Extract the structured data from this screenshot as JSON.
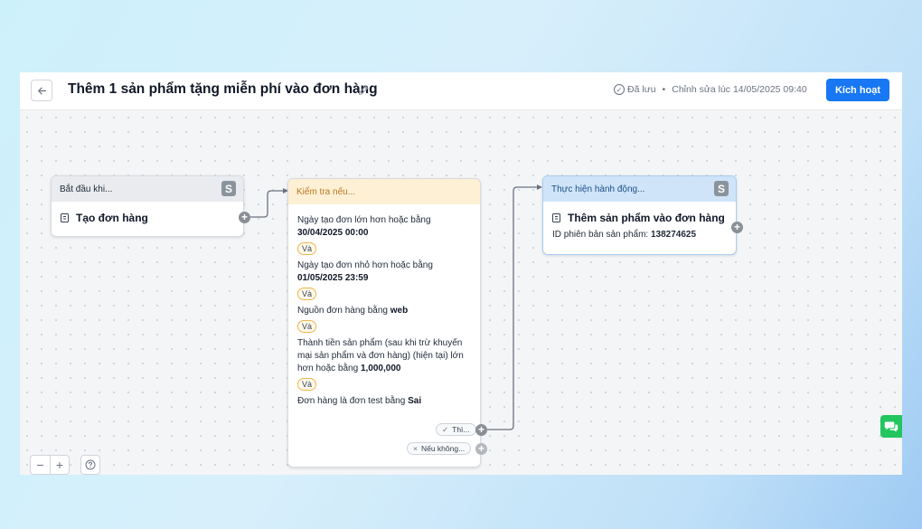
{
  "header": {
    "back_icon": "arrow-left-icon",
    "title": "Thêm 1 sản phẩm tặng miễn phí vào đơn hàng",
    "edit_icon": "pencil-icon",
    "saved_label": "Đã lưu",
    "separator": "•",
    "edited_at": "Chỉnh sửa lúc 14/05/2025 09:40",
    "activate_label": "Kích hoạt",
    "activate_color": "#1877f2"
  },
  "nodes": {
    "trigger": {
      "header": "Bắt đầu khi...",
      "badge": "S",
      "title": "Tạo đơn hàng"
    },
    "condition": {
      "header": "Kiểm tra nếu...",
      "header_color": "#fdf0d5",
      "connector": "Và",
      "rules": [
        {
          "text": "Ngày tạo đơn lớn hơn hoặc bằng",
          "value": "30/04/2025 00:00"
        },
        {
          "text": "Ngày tạo đơn nhỏ hơn hoặc bằng",
          "value": "01/05/2025 23:59"
        },
        {
          "text": "Nguồn đơn hàng bằng",
          "value": "web"
        },
        {
          "text_line1": "Thành tiền sản phẩm (sau khi trừ khuyến",
          "text_line2": "mại sản phẩm và đơn hàng) (hiện tại) lớn",
          "text_line3": "hơn hoặc bằng",
          "value": "1,000,000"
        },
        {
          "text": "Đơn hàng là đơn test bằng",
          "value": "Sai"
        }
      ],
      "then_label": "Thì...",
      "else_label": "Nếu không..."
    },
    "action": {
      "header": "Thực hiện hành động...",
      "header_color": "#cfe4f8",
      "badge": "S",
      "title": "Thêm sản phẩm vào đơn hàng",
      "detail_label": "ID phiên bản sản phẩm:",
      "detail_value": "138274625"
    }
  },
  "controls": {
    "zoom_out": "−",
    "zoom_in": "+",
    "help_icon": "question-circle-icon",
    "chat_icon": "chat-bubbles-icon",
    "chat_color": "#22c55e"
  }
}
